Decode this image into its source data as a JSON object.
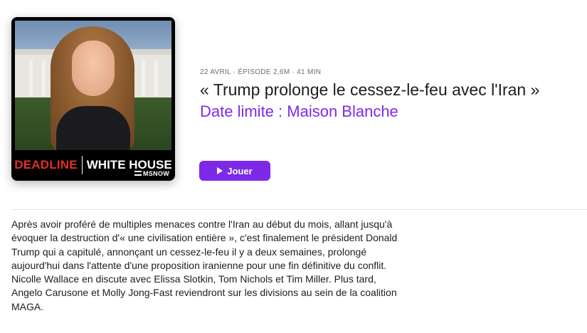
{
  "artwork": {
    "brand_left": "DEADLINE",
    "brand_right": "WHITE HOUSE",
    "network": "MSNOW",
    "colors": {
      "brand_red": "#e0302b",
      "background": "#000000"
    }
  },
  "episode": {
    "meta": "22 AVRIL · ÉPISODE 2,6M · 41 MIN",
    "title": "« Trump prolonge le cessez-le-feu avec l'Iran »",
    "show_name": "Date limite : Maison Blanche",
    "play_label": "Jouer",
    "description": "Après avoir proféré de multiples menaces contre l'Iran au début du mois, allant jusqu'à évoquer la destruction d'« une civilisation entière », c'est finalement le président Donald Trump qui a capitulé, annonçant un cessez-le-feu il y a deux semaines, prolongé aujourd'hui dans l'attente d'une proposition iranienne pour une fin définitive du conflit. Nicolle Wallace en discute avec Elissa Slotkin, Tom Nichols et Tim Miller. Plus tard, Angelo Carusone et Molly Jong-Fast reviendront sur les divisions au sein de la coalition MAGA."
  },
  "theme": {
    "accent": "#7d2ae8",
    "text": "#1d1d1f",
    "secondary_text": "#6e6e73"
  },
  "icons": {
    "play": "play-icon"
  }
}
